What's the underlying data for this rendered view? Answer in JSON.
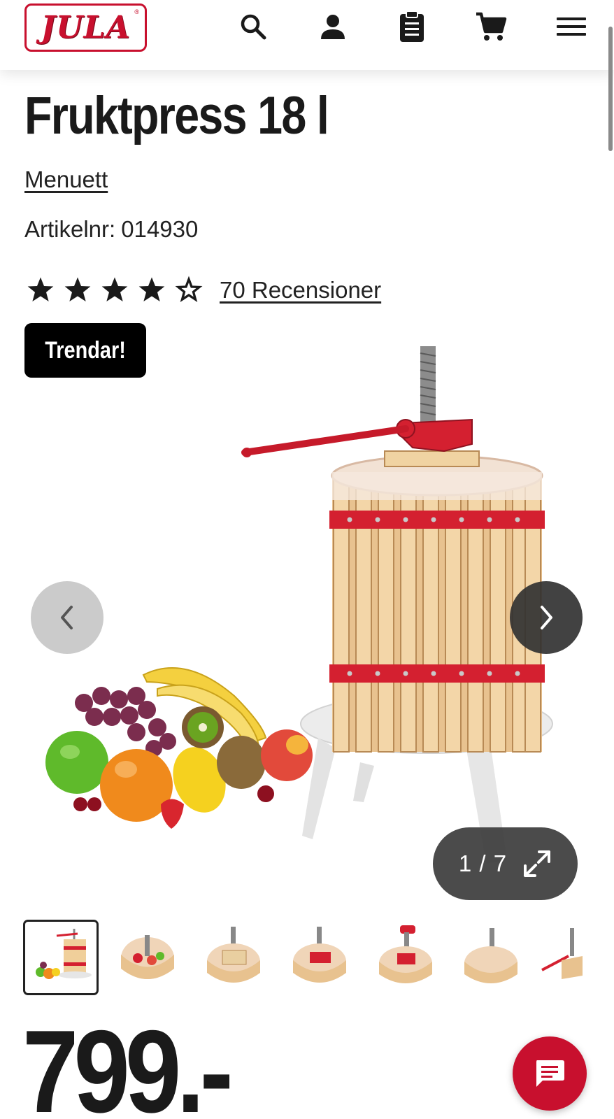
{
  "header": {
    "logo_text": "JULA",
    "logo_reg": "®",
    "icons": [
      "search-icon",
      "account-icon",
      "clipboard-icon",
      "cart-icon",
      "menu-icon"
    ]
  },
  "product": {
    "title": "Fruktpress 18 l",
    "brand": "Menuett",
    "sku_label": "Artikelnr:",
    "sku": "014930",
    "rating": 4,
    "rating_max": 5,
    "reviews_label": "70 Recensioner",
    "badge": "Trendar!",
    "price": "799.-"
  },
  "gallery": {
    "counter": "1 / 7",
    "thumbnail_count": 7,
    "active_index": 0
  },
  "colors": {
    "brand_red": "#c8102e",
    "text": "#1a1a1a"
  }
}
